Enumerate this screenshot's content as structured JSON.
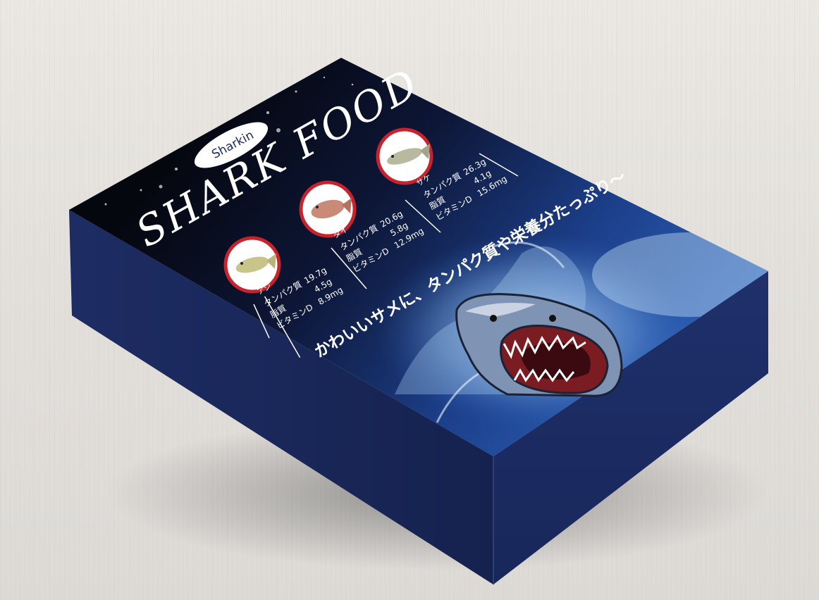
{
  "product": {
    "brand_logo_text": "Sharkin",
    "title": "SHARK FOOD",
    "tagline": "かわいいサメに、タンパク質や栄養分たっぷり〜"
  },
  "fish": [
    {
      "name": "アジ",
      "nutrients": [
        {
          "label": "タンパク質",
          "value": "19.7g"
        },
        {
          "label": "脂質",
          "value": "4.5g"
        },
        {
          "label": "ビタミンD",
          "value": "8.9mg"
        }
      ],
      "fish_color": "#c9c58a"
    },
    {
      "name": "タイ",
      "nutrients": [
        {
          "label": "タンパク質",
          "value": "20.6g"
        },
        {
          "label": "脂質",
          "value": "5.8g"
        },
        {
          "label": "ビタミンD",
          "value": "12.9mg"
        }
      ],
      "fish_color": "#c98a78"
    },
    {
      "name": "サケ",
      "nutrients": [
        {
          "label": "タンパク質",
          "value": "26.3g"
        },
        {
          "label": "脂質",
          "value": "4.1g"
        },
        {
          "label": "ビタミンD",
          "value": "15.6mg"
        }
      ],
      "fish_color": "#b9b9a0"
    }
  ],
  "colors": {
    "box_side": "#1a2a5e",
    "box_front": "#1c2c63",
    "top_dark": "#0a0f22",
    "top_blue": "#1c3f8a",
    "badge_ring": "#c8232c"
  }
}
